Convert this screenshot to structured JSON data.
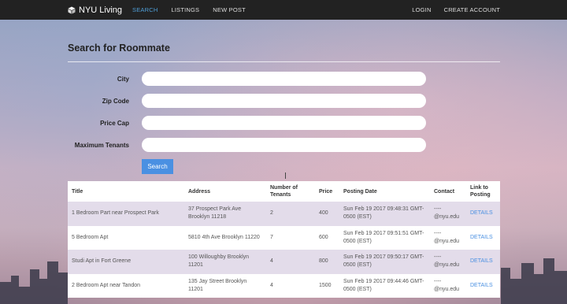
{
  "navbar": {
    "brand": "NYU Living",
    "left_links": [
      {
        "label": "SEARCH",
        "active": true
      },
      {
        "label": "LISTINGS",
        "active": false
      },
      {
        "label": "NEW POST",
        "active": false
      }
    ],
    "right_links": [
      {
        "label": "LOGIN"
      },
      {
        "label": "CREATE ACCOUNT"
      }
    ]
  },
  "page": {
    "title": "Search for Roommate"
  },
  "form": {
    "fields": [
      {
        "label": "City",
        "value": ""
      },
      {
        "label": "Zip Code",
        "value": ""
      },
      {
        "label": "Price Cap",
        "value": ""
      },
      {
        "label": "Maximum Tenants",
        "value": ""
      }
    ],
    "search_button": "Search"
  },
  "table": {
    "headers": [
      "Title",
      "Address",
      "Number of Tenants",
      "Price",
      "Posting Date",
      "Contact",
      "Link to Posting"
    ],
    "rows": [
      {
        "title": "1 Bedroom Part near Prospect Park",
        "address": "37 Prospect Park Ave Brooklyn 11218",
        "tenants": "2",
        "price": "400",
        "date": "Sun Feb 19 2017 09:48:31 GMT-0500 (EST)",
        "contact": "---- @nyu.edu",
        "link": "DETAILS"
      },
      {
        "title": "5 Bedroom Apt",
        "address": "5810 4th Ave Brooklyn 11220",
        "tenants": "7",
        "price": "600",
        "date": "Sun Feb 19 2017 09:51:51 GMT-0500 (EST)",
        "contact": "---- @nyu.edu",
        "link": "DETAILS"
      },
      {
        "title": "Studi Apt in Fort Greene",
        "address": "100 Willoughby Brooklyn 11201",
        "tenants": "4",
        "price": "800",
        "date": "Sun Feb 19 2017 09:50:17 GMT-0500 (EST)",
        "contact": "---- @nyu.edu",
        "link": "DETAILS"
      },
      {
        "title": "2 Bedroom Apt near Tandon",
        "address": "135 Jay Street Brooklyn 11201",
        "tenants": "4",
        "price": "1500",
        "date": "Sun Feb 19 2017 09:44:46 GMT-0500 (EST)",
        "contact": "---- @nyu.edu",
        "link": "DETAILS"
      }
    ]
  }
}
